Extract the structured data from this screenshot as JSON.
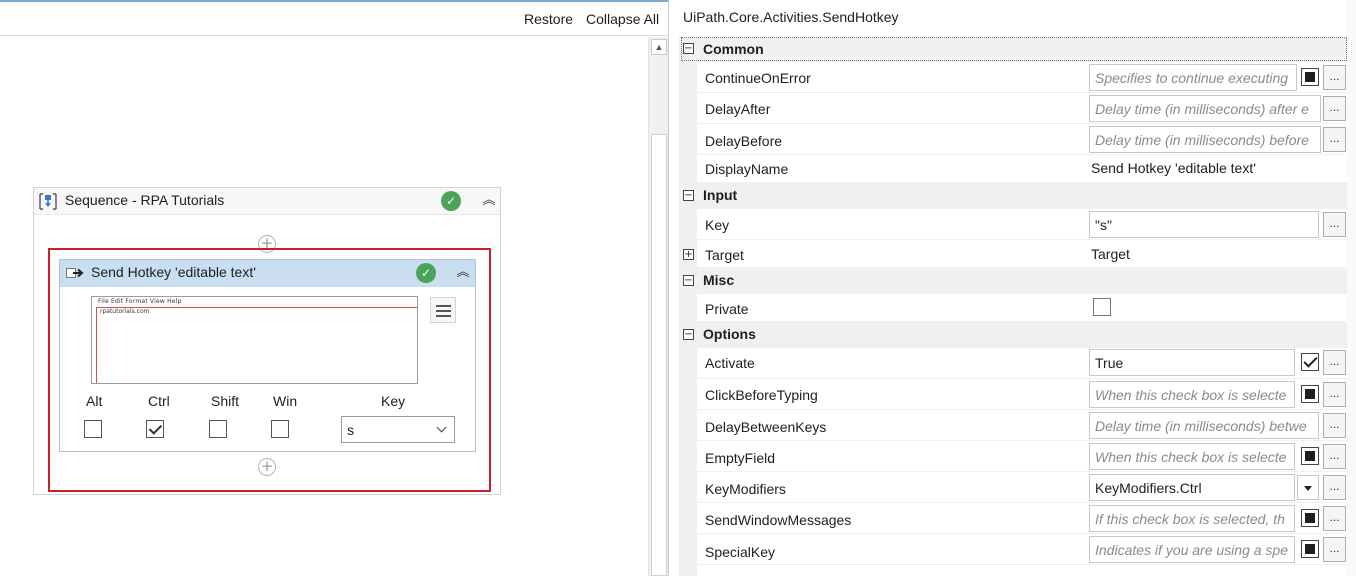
{
  "designer": {
    "restore_label": "Restore",
    "collapse_all_label": "Collapse All",
    "sequence": {
      "title": "Sequence - RPA Tutorials",
      "status_icon": "check-circle-icon",
      "collapse_icon": "double-chevron-up-icon"
    },
    "send_hotkey": {
      "title": "Send Hotkey 'editable text'",
      "status_icon": "check-circle-icon",
      "screenshot": {
        "menu_text": "File  Edit  Format  View  Help",
        "content_text": "rpatutorials.com"
      },
      "modifiers": [
        {
          "label": "Alt",
          "checked": false
        },
        {
          "label": "Ctrl",
          "checked": true
        },
        {
          "label": "Shift",
          "checked": false
        },
        {
          "label": "Win",
          "checked": false
        }
      ],
      "key_label": "Key",
      "key_value": "s"
    },
    "accent_color": "#c9def0",
    "highlight_color": "#c8202a"
  },
  "properties": {
    "title": "UiPath.Core.Activities.SendHotkey",
    "categories": {
      "common": "Common",
      "input": "Input",
      "misc": "Misc",
      "options": "Options"
    },
    "rows": {
      "continue_on_error": {
        "name": "ContinueOnError",
        "placeholder": "Specifies to continue executing"
      },
      "delay_after": {
        "name": "DelayAfter",
        "placeholder": "Delay time (in milliseconds) after e"
      },
      "delay_before": {
        "name": "DelayBefore",
        "placeholder": "Delay time (in milliseconds) before"
      },
      "display_name": {
        "name": "DisplayName",
        "value": "Send Hotkey 'editable text'"
      },
      "key": {
        "name": "Key",
        "value": "\"s\""
      },
      "target": {
        "name": "Target",
        "value": "Target"
      },
      "private": {
        "name": "Private",
        "checked": false
      },
      "activate": {
        "name": "Activate",
        "value": "True",
        "checked": true
      },
      "click_before_typing": {
        "name": "ClickBeforeTyping",
        "placeholder": "When this check box is selecte"
      },
      "delay_between_keys": {
        "name": "DelayBetweenKeys",
        "placeholder": "Delay time (in milliseconds) betwe"
      },
      "empty_field": {
        "name": "EmptyField",
        "placeholder": "When this check box is selecte"
      },
      "key_modifiers": {
        "name": "KeyModifiers",
        "value": "KeyModifiers.Ctrl"
      },
      "send_window_messages": {
        "name": "SendWindowMessages",
        "placeholder": "If this check box is selected, th"
      },
      "special_key": {
        "name": "SpecialKey",
        "placeholder": "Indicates if you are using a spe"
      }
    },
    "ellipsis_label": "...",
    "expand_symbol": "+",
    "collapse_symbol": "−"
  }
}
